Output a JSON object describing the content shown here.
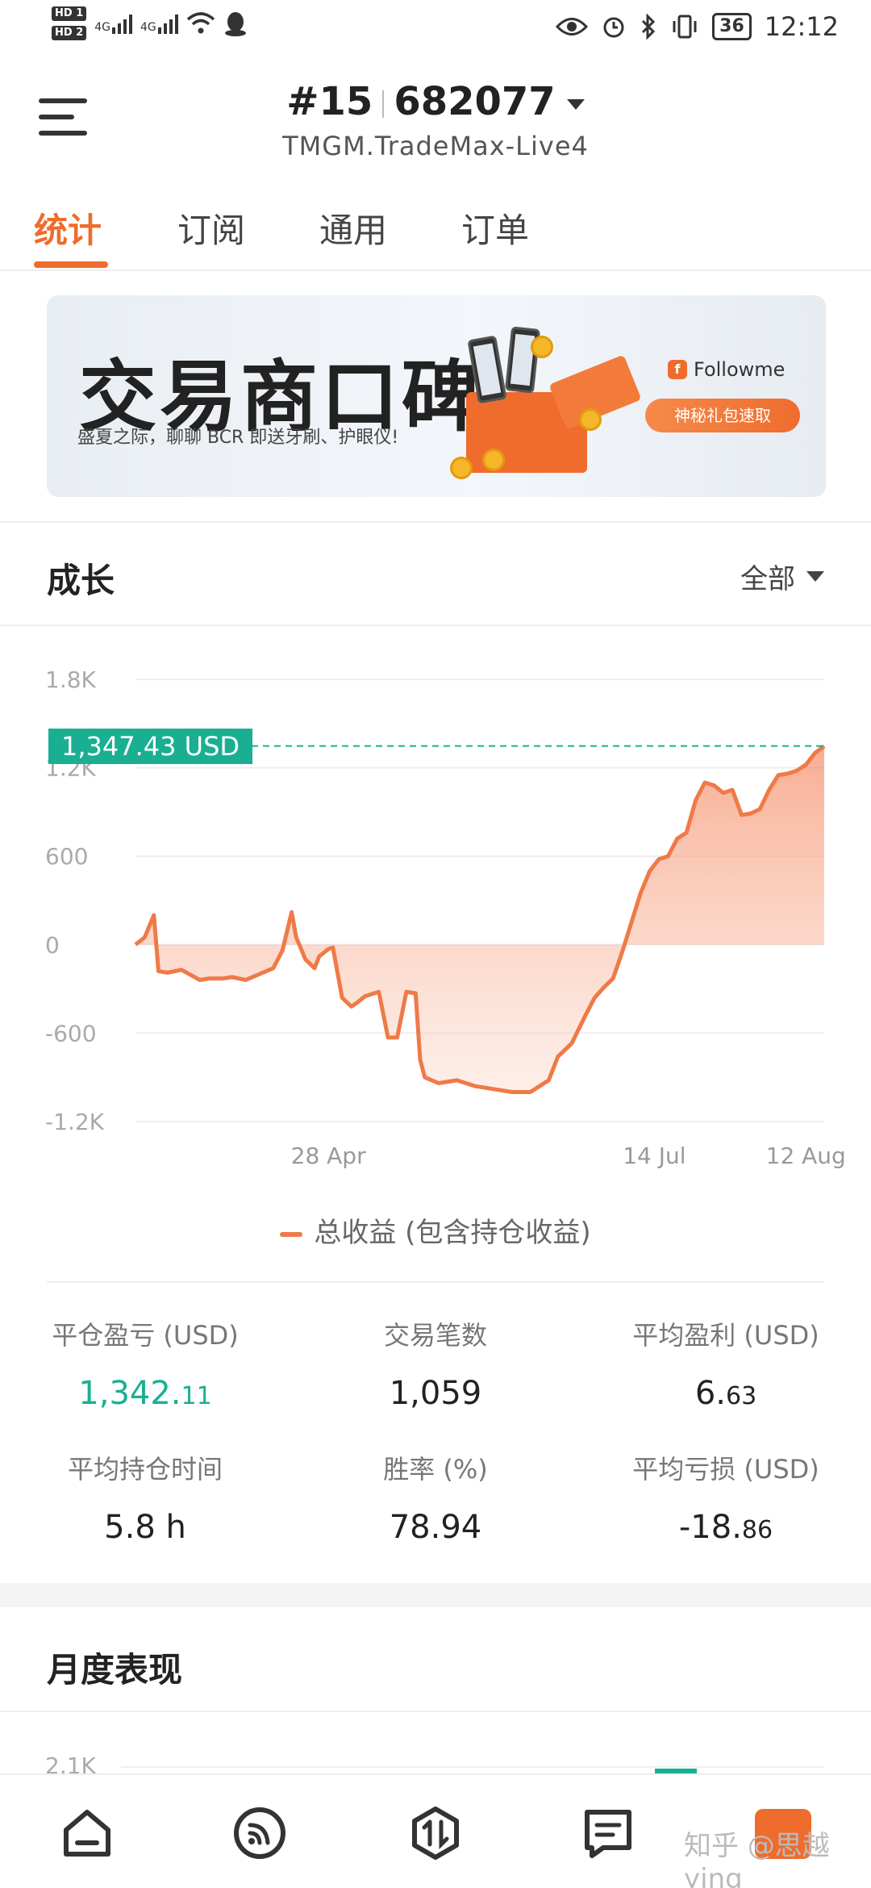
{
  "status_bar": {
    "sim1": "HD 1",
    "sim2": "HD 2",
    "net1": "4G",
    "net2": "4G",
    "battery": "36",
    "time": "12:12"
  },
  "header": {
    "rank": "#15",
    "account": "682077",
    "server": "TMGM.TradeMax-Live4"
  },
  "tabs": [
    "统计",
    "订阅",
    "通用",
    "订单"
  ],
  "banner": {
    "title": "交易商口碑",
    "subtitle": "盛夏之际，聊聊 BCR 即送牙刷、护眼仪!",
    "brand": "Followme",
    "brand_mark": "f",
    "cta": "神秘礼包速取"
  },
  "growth": {
    "title": "成长",
    "range": "全部",
    "current_label": "1,347.43 USD",
    "legend": "总收益 (包含持仓收益)"
  },
  "chart_data": {
    "type": "area",
    "y_ticks": [
      "1.8K",
      "1.2K",
      "600",
      "0",
      "-600",
      "-1.2K"
    ],
    "y_tick_values": [
      1800,
      1200,
      600,
      0,
      -600,
      -1200
    ],
    "ylim": [
      -1200,
      1800
    ],
    "x_ticks": [
      "28 Apr",
      "14 Jul",
      "12 Aug"
    ],
    "x_tick_positions": [
      42,
      113,
      146
    ],
    "x_range": [
      0,
      150
    ],
    "current_value": 1347.43,
    "series": [
      {
        "name": "总收益 (包含持仓收益)",
        "color": "#ef7a48",
        "x": [
          0,
          2,
          4,
          5,
          7,
          10,
          14,
          16,
          19,
          21,
          24,
          27,
          30,
          32,
          34,
          35,
          37,
          39,
          40,
          42,
          43,
          45,
          47,
          48,
          50,
          53,
          55,
          57,
          59,
          61,
          62,
          63,
          66,
          70,
          74,
          78,
          82,
          86,
          90,
          92,
          95,
          98,
          100,
          102,
          104,
          106,
          108,
          110,
          112,
          114,
          116,
          118,
          120,
          122,
          124,
          126,
          128,
          130,
          132,
          134,
          136,
          138,
          140,
          142,
          144,
          146,
          148,
          150
        ],
        "values": [
          0,
          50,
          200,
          -180,
          -190,
          -170,
          -240,
          -230,
          -230,
          -220,
          -240,
          -200,
          -160,
          -40,
          220,
          50,
          -100,
          -160,
          -80,
          -30,
          -20,
          -360,
          -420,
          -400,
          -350,
          -320,
          -630,
          -630,
          -320,
          -330,
          -780,
          -900,
          -940,
          -920,
          -960,
          -980,
          -1000,
          -1000,
          -920,
          -760,
          -670,
          -480,
          -360,
          -290,
          -230,
          -50,
          150,
          350,
          500,
          580,
          600,
          720,
          760,
          980,
          1100,
          1080,
          1030,
          1050,
          880,
          890,
          920,
          1050,
          1150,
          1160,
          1180,
          1220,
          1300,
          1347
        ]
      }
    ]
  },
  "stats": [
    {
      "label": "平仓盈亏 (USD)",
      "value_main": "1,342.",
      "value_small": "11",
      "positive": true
    },
    {
      "label": "交易笔数",
      "value_main": "1,059",
      "value_small": "",
      "positive": false
    },
    {
      "label": "平均盈利 (USD)",
      "value_main": "6.",
      "value_small": "63",
      "positive": false
    },
    {
      "label": "平均持仓时间",
      "value_main": "5.8 h",
      "value_small": "",
      "positive": false
    },
    {
      "label": "胜率 (%)",
      "value_main": "78.94",
      "value_small": "",
      "positive": false
    },
    {
      "label": "平均亏损 (USD)",
      "value_main": "-18.",
      "value_small": "86",
      "positive": false
    }
  ],
  "monthly": {
    "title": "月度表现",
    "first_tick": "2.1K"
  },
  "watermark": "知乎 @思越ying",
  "colors": {
    "accent": "#ef6c2d",
    "positive": "#1aaf92",
    "line": "#ef7a48"
  }
}
